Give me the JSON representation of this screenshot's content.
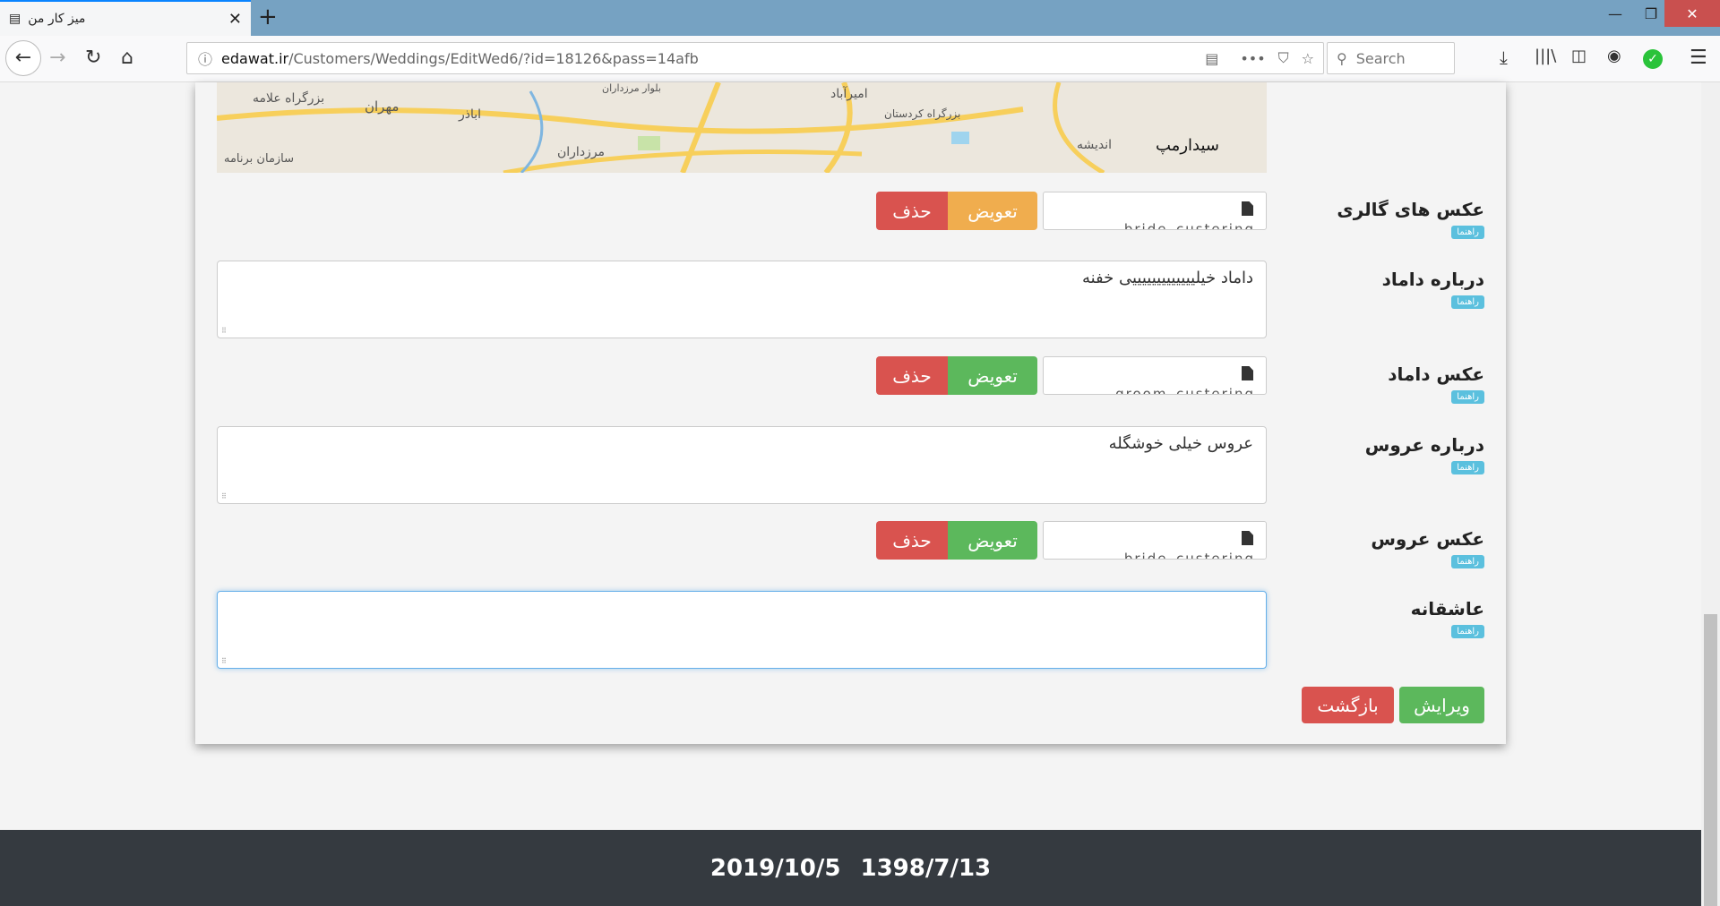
{
  "browser": {
    "tab_title": "میز کار من",
    "url_host": "edawat.ir",
    "url_path": "/Customers/Weddings/EditWed6/?id=18126&pass=14afb",
    "search_placeholder": "Search"
  },
  "map": {
    "labels": [
      "بزرگراه علامه",
      "مهران",
      "اباذر",
      "مرزداران",
      "امیرآباد",
      "بزرگراه کردستان",
      "سازمان برنامه",
      "سیدارمپ",
      "اندیشه",
      "بلوار مرزداران"
    ]
  },
  "form": {
    "help_label": "راهنما",
    "gallery": {
      "label": "عکس های گالری",
      "file": "bride_custering",
      "replace": "تعویض",
      "delete": "حذف"
    },
    "about_groom": {
      "label": "درباره داماد",
      "value": "داماد خیلیییییییییییییی خفنه"
    },
    "groom_photo": {
      "label": "عکس داماد",
      "file": "groom_custering",
      "replace": "تعویض",
      "delete": "حذف"
    },
    "about_bride": {
      "label": "درباره عروس",
      "value": "عروس خیلی خوشگله"
    },
    "bride_photo": {
      "label": "عکس عروس",
      "file": "bride_custering",
      "replace": "تعویض",
      "delete": "حذف"
    },
    "romance": {
      "label": "عاشقانه",
      "value": ""
    },
    "edit_button": "ویرایش",
    "back_button": "بازگشت"
  },
  "footer": {
    "gregorian": "2019/10/5",
    "jalali": "1398/7/13"
  },
  "colors": {
    "danger": "#d9534f",
    "warning": "#f0ad4e",
    "success": "#5cb85c",
    "info": "#5bc0de",
    "footer": "#353a40"
  }
}
